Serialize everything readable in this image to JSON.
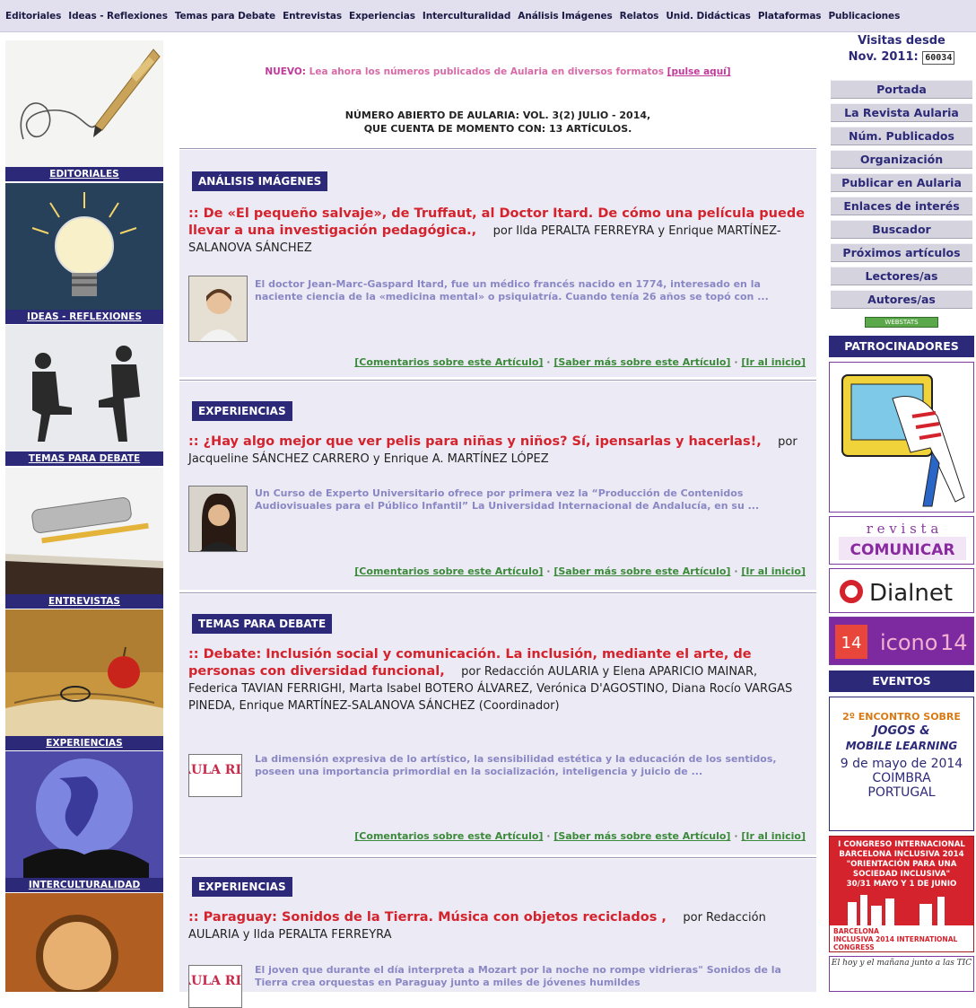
{
  "topnav": [
    "Editoriales",
    "Ideas - Reflexiones",
    "Temas para Debate",
    "Entrevistas",
    "Experiencias",
    "Interculturalidad",
    "Análisis Imágenes",
    "Relatos",
    "Unid. Didácticas",
    "Plataformas",
    "Publicaciones"
  ],
  "left": {
    "items": [
      "EDITORIALES",
      "IDEAS - REFLEXIONES",
      "TEMAS PARA DEBATE",
      "ENTREVISTAS",
      "EXPERIENCIAS",
      "INTERCULTURALIDAD"
    ]
  },
  "promo": {
    "nuevo": "NUEVO:",
    "text": " Lea ahora los números publicados de Aularia en diversos formatos ",
    "link": "[pulse aquí]"
  },
  "numero": {
    "line1": "NÚMERO ABIERTO DE AULARIA: VOL. 3(2) JULIO - 2014,",
    "line2": "QUE CUENTA DE MOMENTO CON: 13 ARTÍCULOS."
  },
  "articles": [
    {
      "tag": "ANÁLISIS IMÁGENES",
      "title": ":: De «El pequeño salvaje», de Truffaut, al Doctor Itard. De cómo una película puede llevar a una investigación pedagógica.,",
      "by": "por Ilda PERALTA FERREYRA y Enrique MARTÍNEZ-SALANOVA SÁNCHEZ",
      "summary": "El doctor Jean-Marc-Gaspard Itard, fue un médico francés nacido en 1774, interesado en la naciente ciencia de la «medicina mental» o psiquiatría. Cuando tenía 26 años se topó con ..."
    },
    {
      "tag": "EXPERIENCIAS",
      "title": ":: ¿Hay algo mejor que ver pelis para niñas y niños? Sí, ipensarlas y hacerlas!,",
      "by": "por Jacqueline SÁNCHEZ CARRERO y Enrique A. MARTÍNEZ LÓPEZ",
      "summary": "Un Curso de Experto Universitario ofrece por primera vez la “Producción de Contenidos Audiovisuales para el Público Infantil” La Universidad Internacional de Andalucía, en su ..."
    },
    {
      "tag": "TEMAS PARA DEBATE",
      "title": ":: Debate: Inclusión social y comunicación. La inclusión, mediante el arte, de personas con diversidad funcional,",
      "by": "por Redacción AULARIA y Elena APARICIO MAINAR, Federica TAVIAN FERRIGHI, Marta Isabel BOTERO ÁLVAREZ, Verónica D'AGOSTINO, Diana Rocío VARGAS PINEDA, Enrique MARTÍNEZ-SALANOVA SÁNCHEZ (Coordinador)",
      "summary": "La dimensión expresiva de lo artístico, la sensibilidad estética y la educación de los sentidos, poseen una importancia primordial en la socialización, inteligencia y juicio de ..."
    },
    {
      "tag": "EXPERIENCIAS",
      "title": ":: Paraguay: Sonidos de la Tierra. Música con objetos reciclados ,",
      "by": "por Redacción AULARIA y Ilda PERALTA FERREYRA",
      "summary": "El joven que durante el día interpreta a Mozart por la noche no rompe vidrieras\" Sonidos de la Tierra crea orquestas en Paraguay junto a miles de jóvenes humildes"
    }
  ],
  "article_links": {
    "comentarios": "[Comentarios sobre este Artículo]",
    "saber": "[Saber más sobre este Artículo]",
    "inicio": "[Ir al inicio]",
    "sep": "·"
  },
  "aularia_logo_text": "AULA RIA",
  "right": {
    "visitas_line1": "Visitas desde",
    "visitas_line2": "Nov. 2011:",
    "counter": "60034",
    "menu": [
      "Portada",
      "La Revista Aularia",
      "Núm. Publicados",
      "Organización",
      "Publicar en Aularia",
      "Enlaces de interés",
      "Buscador",
      "Próximos artículos",
      "Lectores/as",
      "Autores/as"
    ],
    "webstats": "WEBSTATS",
    "patrocinadores": "PATROCINADORES",
    "comunicar_top": "r e v i s t a",
    "comunicar_word": "COMUNICAR",
    "dialnet": "Dialnet",
    "icono": "icono",
    "icono_num": "14",
    "eventos": "EVENTOS",
    "evento1": {
      "line1": "2º ENCONTRO SOBRE",
      "line2": "JOGOS &",
      "line3": "MOBILE LEARNING",
      "line4": "9 de mayo de 2014",
      "line5": "COIMBRA",
      "line6": "PORTUGAL"
    },
    "evento2": {
      "line1": "I CONGRESO INTERNACIONAL",
      "line2": "BARCELONA INCLUSIVA 2014",
      "line3": "\"ORIENTACIÓN PARA UNA",
      "line4": "SOCIEDAD INCLUSIVA\"",
      "line5": "30/31 MAYO Y 1 DE JUNIO",
      "line6": "BARCELONA",
      "line7": "INCLUSIVA 2014 INTERNATIONAL CONGRESS"
    },
    "evento3": {
      "line1": "El hoy y el mañana junto a las TIC"
    },
    "colors": {
      "navy": "#2c2a78",
      "red": "#d4232d",
      "summary": "#8a88c4",
      "link_green": "#3a8a3a",
      "pink": "#c0399a"
    }
  }
}
